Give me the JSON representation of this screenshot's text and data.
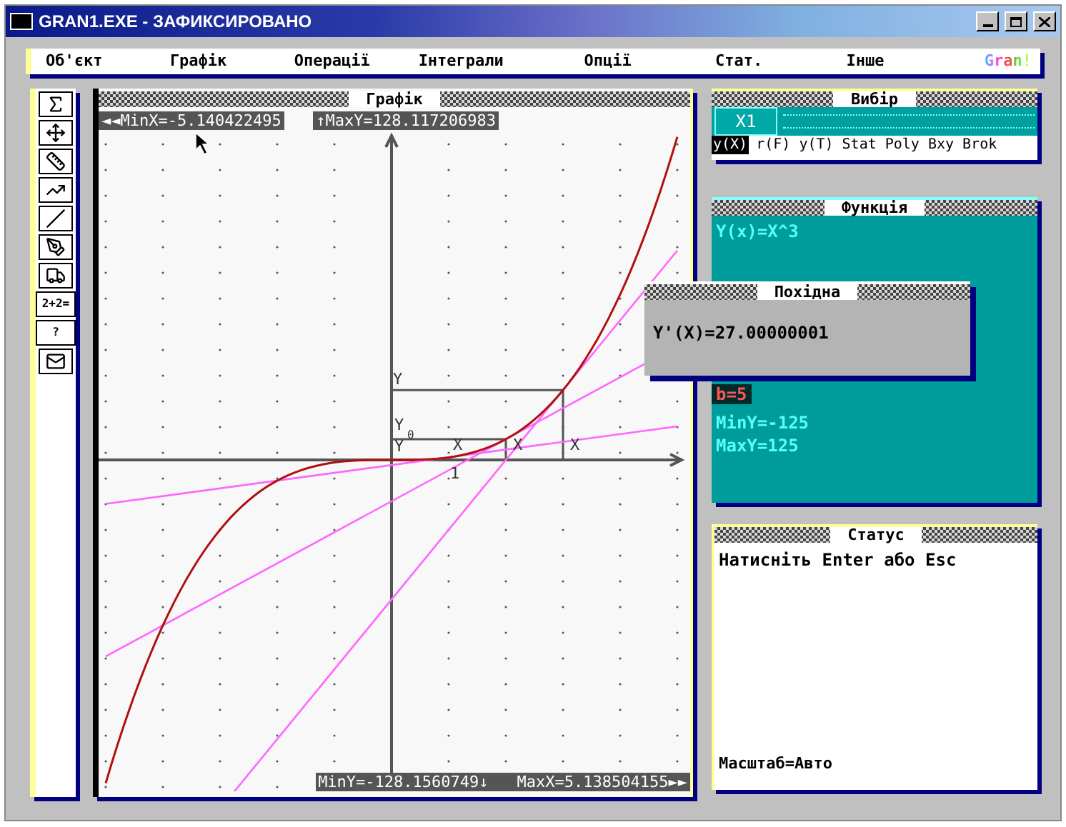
{
  "window": {
    "title": "GRAN1.EXE - ЗАФИКСИРОВАНО"
  },
  "menu": [
    {
      "label": "Об'єкт"
    },
    {
      "label": "Графік"
    },
    {
      "label": "Операції"
    },
    {
      "label": "Інтеграли"
    },
    {
      "label": "Опції"
    },
    {
      "label": "Стат."
    },
    {
      "label": "Інше"
    }
  ],
  "logo": "Gran!",
  "toolbar": [
    {
      "kind": "icon"
    },
    {
      "kind": "icon"
    },
    {
      "kind": "icon"
    },
    {
      "kind": "icon"
    },
    {
      "kind": "icon"
    },
    {
      "kind": "icon"
    },
    {
      "kind": "icon"
    },
    {
      "kind": "text",
      "label": "2+2="
    },
    {
      "kind": "text",
      "label": "?"
    },
    {
      "kind": "icon"
    }
  ],
  "graph": {
    "title": "Графік",
    "min_x": "◄◄MinX=-5.140422495",
    "max_y": "↑MaxY=128.117206983",
    "min_y": "MinY=-128.1560749↓",
    "max_x": "MaxX=5.138504155►►",
    "axis_labels": [
      "Y",
      "Y",
      "0",
      "Y",
      "X",
      "X",
      "X",
      "1"
    ]
  },
  "selector": {
    "title": "Вибір",
    "field": "X1",
    "tabs": [
      {
        "label": "y(X)",
        "selected": true
      },
      {
        "label": "r(F)",
        "selected": false
      },
      {
        "label": "y(T)",
        "selected": false
      },
      {
        "label": "Stat",
        "selected": false
      },
      {
        "label": "Poly",
        "selected": false
      },
      {
        "label": "Bxy",
        "selected": false
      },
      {
        "label": "Brok",
        "selected": false
      }
    ]
  },
  "function_panel": {
    "title": "Функція",
    "lines": [
      {
        "text": "Y(x)=X^3",
        "kind": "plain"
      },
      {
        "text": "b=5",
        "kind": "alert"
      },
      {
        "text": "MinY=-125",
        "kind": "plain"
      },
      {
        "text": "MaxY=125",
        "kind": "plain"
      }
    ]
  },
  "derivative_popup": {
    "title": "Похідна",
    "text": "Y'(X)=27.00000001"
  },
  "status_panel": {
    "title": "Статус",
    "message": "Натисніть Enter або Esc",
    "scale": "Масштаб=Авто"
  }
}
